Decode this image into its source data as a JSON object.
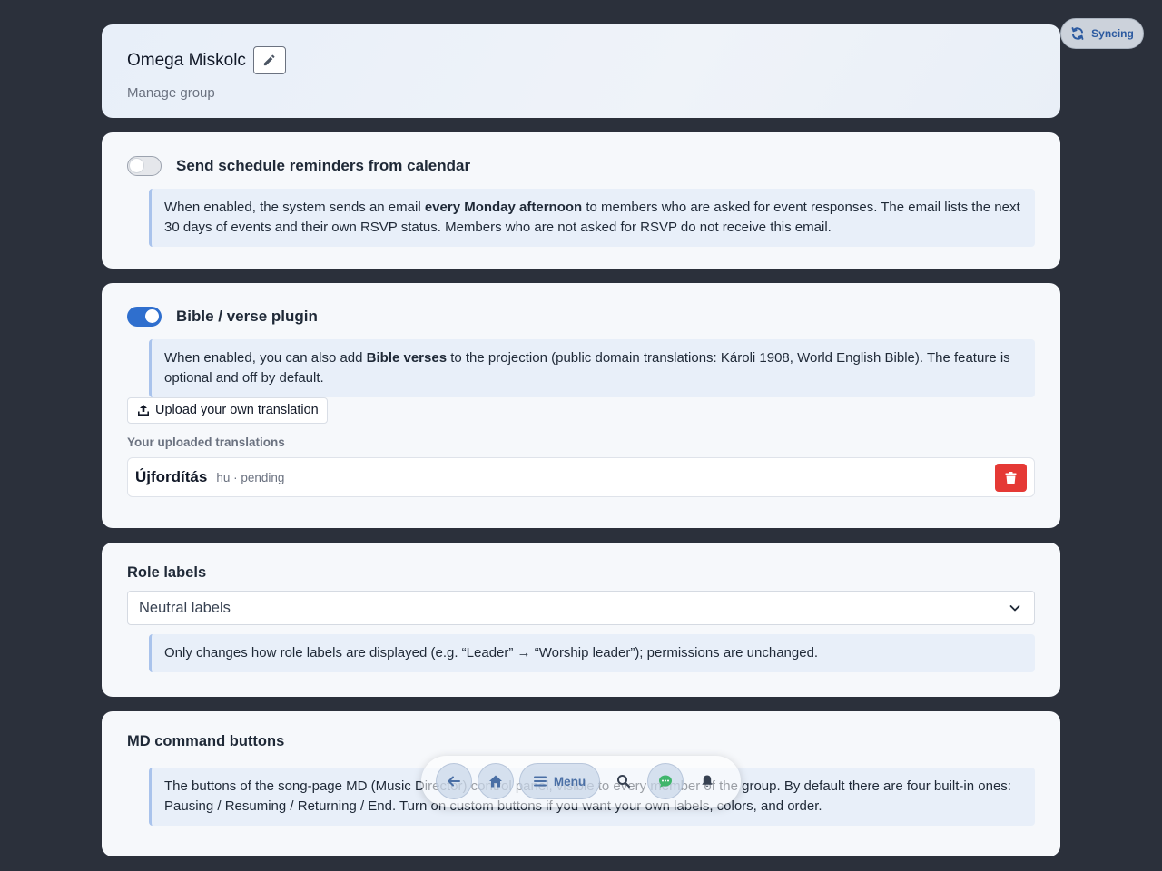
{
  "header": {
    "group_name": "Omega Miskolc",
    "subtitle": "Manage group"
  },
  "sync_badge": {
    "label": "Syncing"
  },
  "schedule_reminders": {
    "title": "Send schedule reminders from calendar",
    "enabled": false,
    "info_pre": "When enabled, the system sends an email ",
    "info_bold": "every Monday afternoon",
    "info_post": " to members who are asked for event responses. The email lists the next 30 days of events and their own RSVP status. Members who are not asked for RSVP do not receive this email."
  },
  "bible_plugin": {
    "title": "Bible / verse plugin",
    "enabled": true,
    "info_pre": "When enabled, you can also add ",
    "info_bold": "Bible verses",
    "info_post": " to the projection (public domain translations: Károli 1908, World English Bible). The feature is optional and off by default.",
    "upload_label": "Upload your own translation",
    "uploaded_heading": "Your uploaded translations",
    "translations": [
      {
        "name": "Újfordítás",
        "meta": "hu · pending"
      }
    ]
  },
  "role_labels": {
    "title": "Role labels",
    "selected": "Neutral labels",
    "info": "Only changes how role labels are displayed (e.g. “Leader” → “Worship leader”); permissions are unchanged."
  },
  "md_buttons": {
    "title": "MD command buttons",
    "info": "The buttons of the song-page MD (Music Director) control panel, visible to every member of the group. By default there are four built-in ones: Pausing / Resuming / Returning / End. Turn on custom buttons if you want your own labels, colors, and order."
  },
  "dock": {
    "menu_label": "Menu"
  },
  "colors": {
    "background": "#2b303b",
    "accent": "#2f6fce",
    "danger": "#e53935"
  }
}
